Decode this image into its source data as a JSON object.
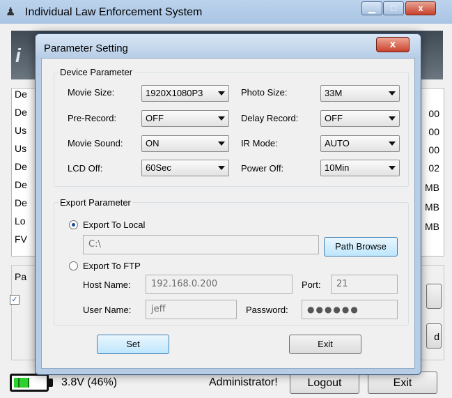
{
  "main_window": {
    "title": "Individual Law Enforcement System",
    "app_icon": "police-figure-icon",
    "banner_logo": "i",
    "info_labels": [
      "De",
      "De",
      "Us",
      "Us",
      "De",
      "De",
      "De",
      "Lo",
      "FV"
    ],
    "info_values": [
      "00",
      "00",
      "00",
      "02",
      "MB",
      "MB",
      "MB"
    ],
    "pa_label": "Pa",
    "checkbox_mark": "✓",
    "side_button_labels": [
      "",
      "d"
    ],
    "battery_text": "3.8V (46%)",
    "battery_level": 0.46,
    "admin_text": "Administrator!",
    "logout_label": "Logout",
    "exit_label": "Exit"
  },
  "dialog": {
    "title": "Parameter Setting",
    "close_glyph": "x",
    "device": {
      "legend": "Device Parameter",
      "movie_size": {
        "label": "Movie Size:",
        "value": "1920X1080P3"
      },
      "photo_size": {
        "label": "Photo Size:",
        "value": "33M"
      },
      "pre_record": {
        "label": "Pre-Record:",
        "value": "OFF"
      },
      "delay_record": {
        "label": "Delay Record:",
        "value": "OFF"
      },
      "movie_sound": {
        "label": "Movie Sound:",
        "value": "ON"
      },
      "ir_mode": {
        "label": "IR Mode:",
        "value": "AUTO"
      },
      "lcd_off": {
        "label": "LCD Off:",
        "value": "60Sec"
      },
      "power_off": {
        "label": "Power Off:",
        "value": "10Min"
      }
    },
    "export": {
      "legend": "Export Parameter",
      "local_label": "Export To Local",
      "local_selected": true,
      "local_path": "C:\\",
      "path_browse_label": "Path Browse",
      "ftp_label": "Export To FTP",
      "ftp_selected": false,
      "host_label": "Host Name:",
      "host_value": "192.168.0.200",
      "port_label": "Port:",
      "port_value": "21",
      "user_label": "User Name:",
      "user_value": "jeff",
      "password_label": "Password:",
      "password_value": "●●●●●●"
    },
    "set_label": "Set",
    "exit_label": "Exit"
  }
}
